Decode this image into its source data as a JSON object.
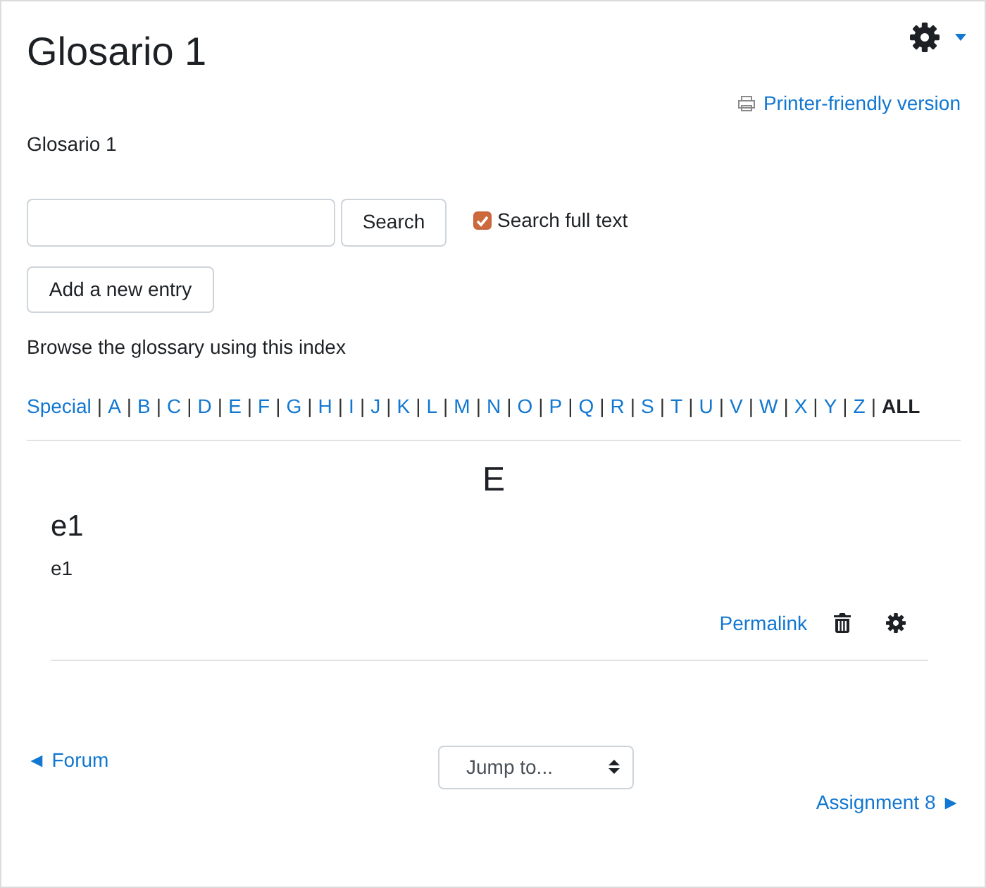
{
  "page": {
    "title": "Glosario 1",
    "printer_link": "Printer-friendly version",
    "description": "Glosario 1"
  },
  "search": {
    "button": "Search",
    "full_text": {
      "label": "Search full text",
      "checked": true
    }
  },
  "add_entry_button": "Add a new entry",
  "browse": {
    "instructions": "Browse the glossary using this index",
    "index": [
      {
        "label": "Special",
        "selected": false,
        "separator": "|"
      },
      {
        "label": "A",
        "selected": false,
        "separator": "|"
      },
      {
        "label": "B",
        "selected": false,
        "separator": "|"
      },
      {
        "label": "C",
        "selected": false,
        "separator": "|"
      },
      {
        "label": "D",
        "selected": false,
        "separator": "|"
      },
      {
        "label": "E",
        "selected": false,
        "separator": "|"
      },
      {
        "label": "F",
        "selected": false,
        "separator": "|"
      },
      {
        "label": "G",
        "selected": false,
        "separator": "|"
      },
      {
        "label": "H",
        "selected": false,
        "separator": "|"
      },
      {
        "label": "I",
        "selected": false,
        "separator": "|"
      },
      {
        "label": "J",
        "selected": false,
        "separator": "|"
      },
      {
        "label": "K",
        "selected": false,
        "separator": "|"
      },
      {
        "label": "L",
        "selected": false,
        "separator": "|"
      },
      {
        "label": "M",
        "selected": false,
        "separator": "|"
      },
      {
        "label": "N",
        "selected": false,
        "separator": "|"
      },
      {
        "label": "O",
        "selected": false,
        "separator": "|"
      },
      {
        "label": "P",
        "selected": false,
        "separator": "|"
      },
      {
        "label": "Q",
        "selected": false,
        "separator": "|"
      },
      {
        "label": "R",
        "selected": false,
        "separator": "|"
      },
      {
        "label": "S",
        "selected": false,
        "separator": "|"
      },
      {
        "label": "T",
        "selected": false,
        "separator": "|"
      },
      {
        "label": "U",
        "selected": false,
        "separator": "|"
      },
      {
        "label": "V",
        "selected": false,
        "separator": "|"
      },
      {
        "label": "W",
        "selected": false,
        "separator": "|"
      },
      {
        "label": "X",
        "selected": false,
        "separator": "|"
      },
      {
        "label": "Y",
        "selected": false,
        "separator": "|"
      },
      {
        "label": "Z",
        "selected": false,
        "separator": "|"
      },
      {
        "label": "ALL",
        "selected": true
      }
    ]
  },
  "entries": {
    "letter": "E",
    "items": [
      {
        "concept": "e1",
        "definition": "e1",
        "permalink": "Permalink"
      }
    ]
  },
  "navigation": {
    "previous": "◄ Forum",
    "jump_to": "Jump to...",
    "next": "Assignment 8 ►"
  }
}
